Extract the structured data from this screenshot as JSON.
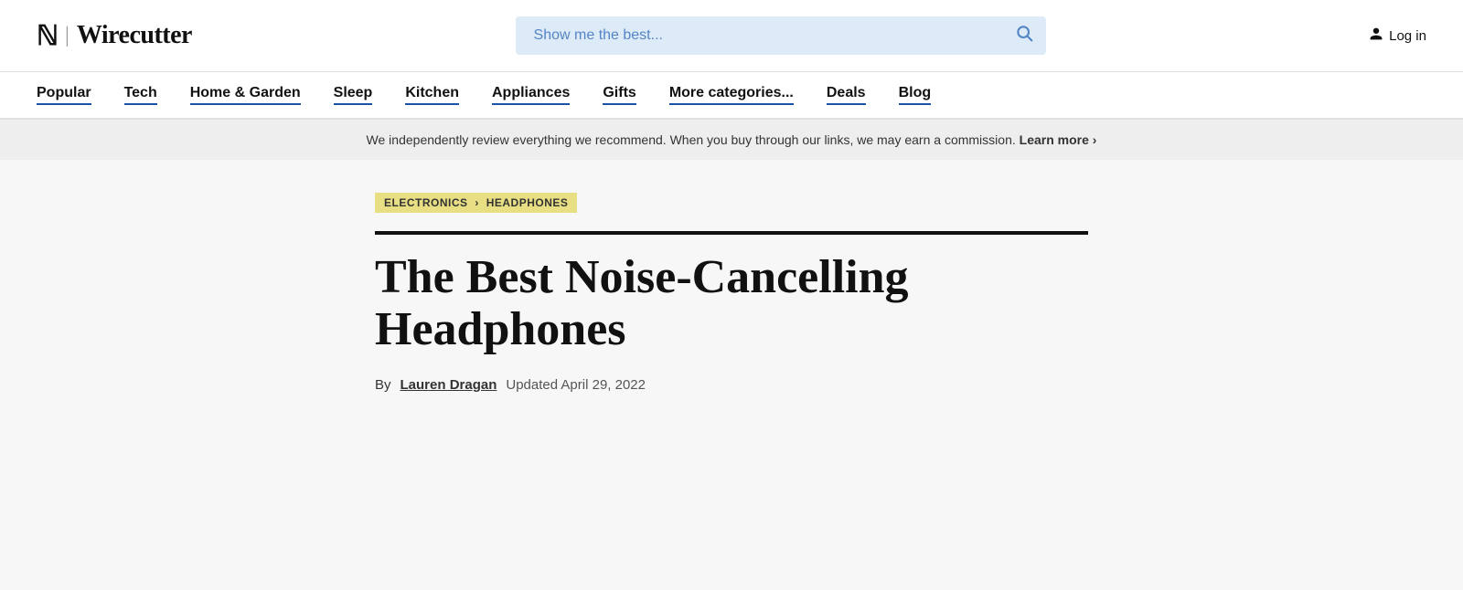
{
  "header": {
    "nyt_logo": "N",
    "pipe": "|",
    "site_name": "Wirecutter",
    "search_placeholder": "Show me the best...",
    "login_label": "Log in"
  },
  "nav": {
    "items": [
      {
        "label": "Popular",
        "id": "popular"
      },
      {
        "label": "Tech",
        "id": "tech"
      },
      {
        "label": "Home & Garden",
        "id": "home-garden"
      },
      {
        "label": "Sleep",
        "id": "sleep"
      },
      {
        "label": "Kitchen",
        "id": "kitchen"
      },
      {
        "label": "Appliances",
        "id": "appliances"
      },
      {
        "label": "Gifts",
        "id": "gifts"
      },
      {
        "label": "More categories...",
        "id": "more-categories"
      },
      {
        "label": "Deals",
        "id": "deals"
      },
      {
        "label": "Blog",
        "id": "blog"
      }
    ]
  },
  "disclaimer": {
    "text": "We independently review everything we recommend. When you buy through our links, we may earn a commission.",
    "learn_more_label": "Learn more ›"
  },
  "article": {
    "breadcrumb": {
      "category": "ELECTRONICS",
      "separator": "›",
      "subcategory": "HEADPHONES"
    },
    "title": "The Best Noise-Cancelling Headphones",
    "byline": {
      "by_text": "By",
      "author": "Lauren Dragan",
      "updated_text": "Updated April 29, 2022"
    }
  },
  "colors": {
    "accent_blue": "#1a52a8",
    "search_bg": "#ddeaf7",
    "breadcrumb_bg": "#e8df84",
    "banner_bg": "#eeeeee"
  }
}
